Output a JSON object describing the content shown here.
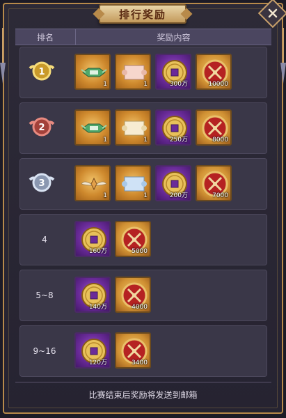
{
  "title": "排行奖励",
  "header": {
    "rank_col": "排名",
    "rewards_col": "奖励内容"
  },
  "rows": [
    {
      "rank": "1",
      "badge": "gold",
      "items": [
        {
          "type": "gold",
          "icon": "title-badge-icon",
          "qty": "1"
        },
        {
          "type": "gold",
          "icon": "scroll-pink-icon",
          "qty": "1"
        },
        {
          "type": "purple",
          "icon": "coin-icon",
          "qty": "300万"
        },
        {
          "type": "red",
          "icon": "swords-medal-icon",
          "qty": "10000"
        }
      ]
    },
    {
      "rank": "2",
      "badge": "red",
      "items": [
        {
          "type": "gold",
          "icon": "title-badge-icon",
          "qty": "1"
        },
        {
          "type": "gold",
          "icon": "scroll-cream-icon",
          "qty": "1"
        },
        {
          "type": "purple",
          "icon": "coin-icon",
          "qty": "250万"
        },
        {
          "type": "red",
          "icon": "swords-medal-icon",
          "qty": "8000"
        }
      ]
    },
    {
      "rank": "3",
      "badge": "silver",
      "items": [
        {
          "type": "gold",
          "icon": "winged-crown-icon",
          "qty": "1"
        },
        {
          "type": "gold",
          "icon": "scroll-blue-icon",
          "qty": "1"
        },
        {
          "type": "purple",
          "icon": "coin-icon",
          "qty": "200万"
        },
        {
          "type": "red",
          "icon": "swords-medal-icon",
          "qty": "7000"
        }
      ]
    },
    {
      "rank": "4",
      "items": [
        {
          "type": "purple",
          "icon": "coin-icon",
          "qty": "160万"
        },
        {
          "type": "red",
          "icon": "swords-medal-icon",
          "qty": "5000"
        }
      ]
    },
    {
      "rank": "5~8",
      "items": [
        {
          "type": "purple",
          "icon": "coin-icon",
          "qty": "140万"
        },
        {
          "type": "red",
          "icon": "swords-medal-icon",
          "qty": "4000"
        }
      ]
    },
    {
      "rank": "9~16",
      "items": [
        {
          "type": "purple",
          "icon": "coin-icon",
          "qty": "120万"
        },
        {
          "type": "red",
          "icon": "swords-medal-icon",
          "qty": "3400"
        }
      ]
    }
  ],
  "footer": "比赛结束后奖励将发送到邮箱",
  "colors": {
    "accent_gold": "#b88a4a",
    "panel": "#3a3748",
    "header": "#4b4660"
  }
}
